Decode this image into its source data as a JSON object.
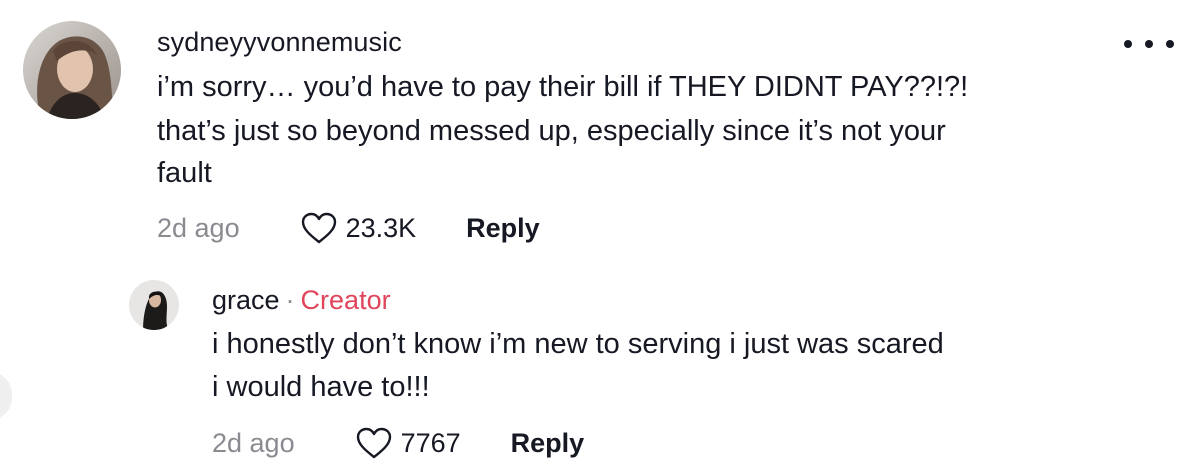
{
  "comment": {
    "username": "sydneyyvonnemusic",
    "text_lines": [
      "i’m sorry… you’d have to pay their bill if THEY DIDNT PAY??!?!",
      "that’s just so beyond messed up, especially since it’s not your",
      "fault"
    ],
    "timestamp": "2d ago",
    "likes": "23.3K",
    "reply_label": "Reply",
    "avatar_icon": "user-avatar-photo",
    "more_icon": "more-options-icon"
  },
  "reply": {
    "username": "grace",
    "separator": "·",
    "badge": "Creator",
    "badge_color": "#e0455b",
    "text_lines": [
      "i honestly don’t know i’m new to serving i just was scared",
      "i would have to!!!"
    ],
    "timestamp": "2d ago",
    "likes": "7767",
    "reply_label": "Reply",
    "avatar_icon": "creator-avatar-photo"
  },
  "colors": {
    "text": "#161823",
    "muted": "#8a8b91",
    "background": "#ffffff"
  }
}
